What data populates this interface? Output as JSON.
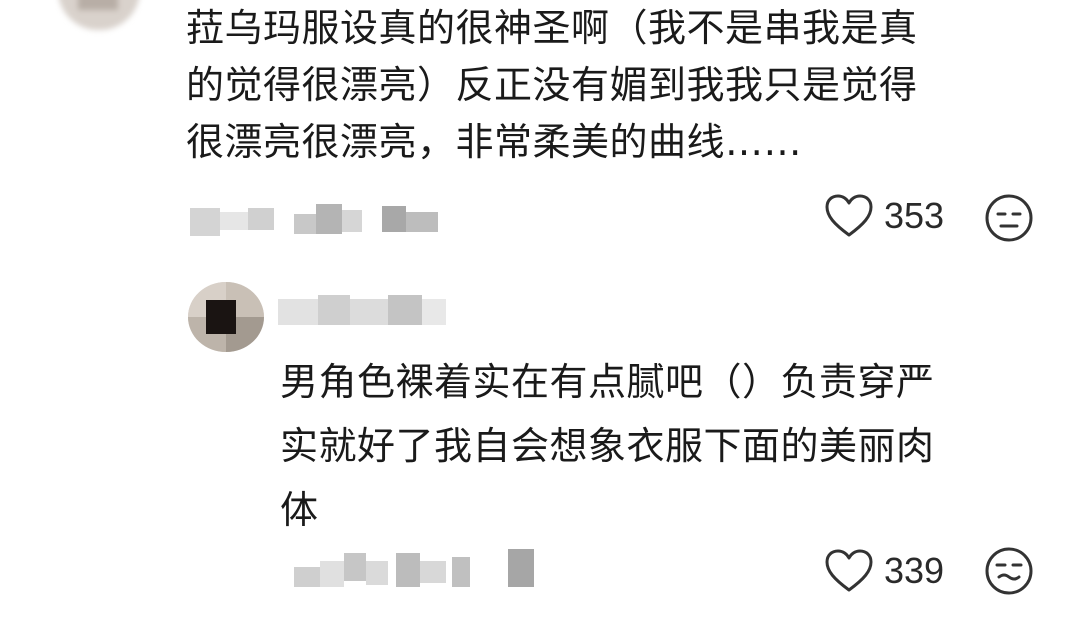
{
  "comments": [
    {
      "text_lines": [
        "菈乌玛服设真的很神圣啊（我不是串我是真",
        "的觉得很漂亮）反正没有媚到我我只是觉得",
        "很漂亮很漂亮，非常柔美的曲线……"
      ],
      "like_count": "353",
      "icons": {
        "like": "heart-outline-icon",
        "reaction": "neutral-face-icon"
      }
    },
    {
      "text_lines": [
        "男角色裸着实在有点腻吧（）负责穿严",
        "实就好了我自会想象衣服下面的美丽肉",
        "体"
      ],
      "like_count": "339",
      "icons": {
        "like": "heart-outline-icon",
        "reaction": "dizzy-face-icon"
      }
    }
  ]
}
